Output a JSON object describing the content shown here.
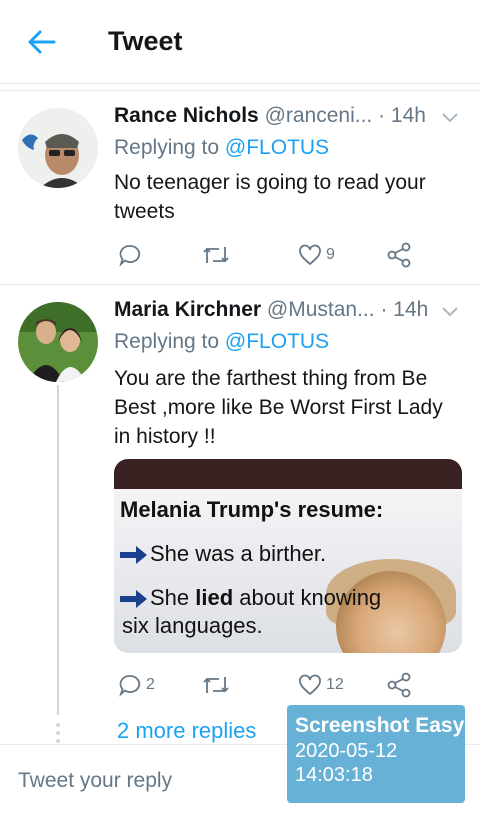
{
  "header": {
    "title": "Tweet",
    "back_icon": "arrow-left-icon"
  },
  "colors": {
    "accent": "#1da1f2",
    "secondary_text": "#657786",
    "divider": "#e6ecf0",
    "watermark": "#5aaad2"
  },
  "tweets": [
    {
      "name": "Rance Nichols",
      "handle": "@ranceni...",
      "time": "· 14h",
      "replying_prefix": "Replying to",
      "replying_to": "@FLOTUS",
      "text": "No teenager is going to read your tweets",
      "actions": {
        "reply_count": "",
        "retweet_count": "",
        "like_count": "9"
      }
    },
    {
      "name": "Maria Kirchner",
      "handle": "@Mustan...",
      "time": "· 14h",
      "replying_prefix": "Replying to",
      "replying_to": "@FLOTUS",
      "text": "You are the farthest thing from Be Best ,more like Be Worst First Lady in history !!",
      "media": {
        "title": "Melania Trump's resume:",
        "line1": "She was a birther.",
        "line2_pre": "She ",
        "line2_bold": "lied",
        "line2_post": " about knowing",
        "line3": "six languages."
      },
      "actions": {
        "reply_count": "2",
        "retweet_count": "",
        "like_count": "12"
      }
    }
  ],
  "more_replies": "2 more replies",
  "reply_box": {
    "placeholder": "Tweet your reply"
  },
  "watermark": {
    "title": "Screenshot Easy",
    "date": "2020-05-12",
    "time": "14:03:18"
  }
}
